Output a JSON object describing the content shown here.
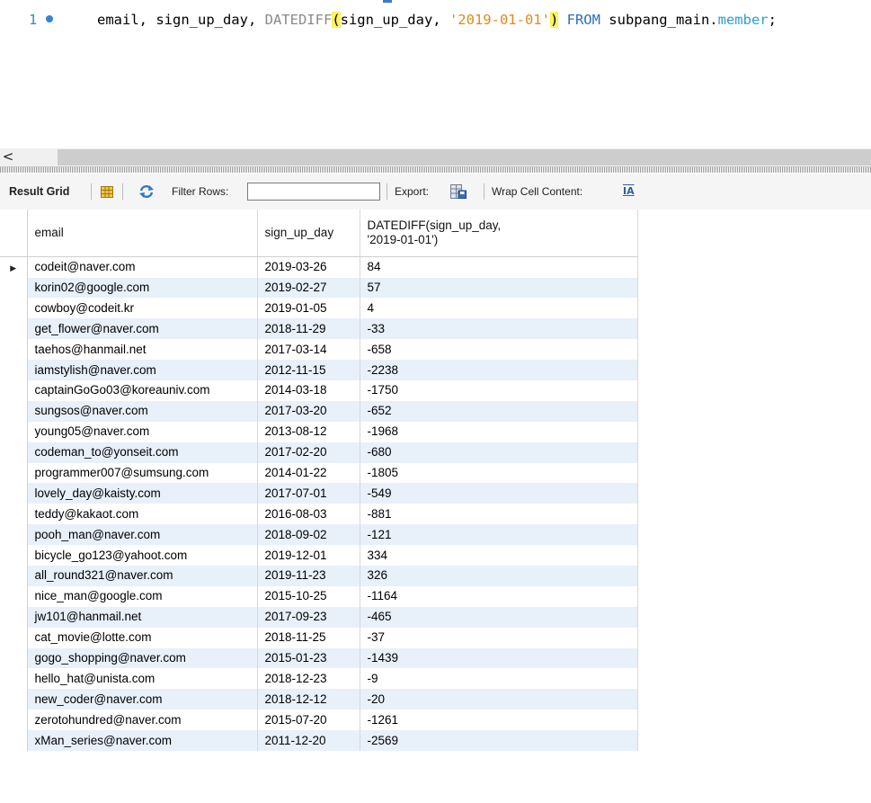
{
  "editor": {
    "line_number": "1",
    "tokens": {
      "t1": "email, sign_up_day, ",
      "t2": "DATEDIFF",
      "t3": "(",
      "t4": "sign_up_day, ",
      "t5": "'2019-01-01'",
      "t6": ")",
      "t7": " FROM",
      "t8": " subpang_main.",
      "t9": "member",
      "t10": ";"
    }
  },
  "scrollbar": {
    "left_arrow": "<"
  },
  "toolbar": {
    "result_grid": "Result Grid",
    "filter_rows": "Filter Rows:",
    "filter_value": "",
    "export": "Export:",
    "wrap_cell_content": "Wrap Cell Content:",
    "wrap_icon_glyph": "IA"
  },
  "grid": {
    "columns": [
      "email",
      "sign_up_day",
      "DATEDIFF(sign_up_day, '2019-01-01')"
    ],
    "column_header_line1": "DATEDIFF(sign_up_day,",
    "column_header_line2": "'2019-01-01')",
    "rows": [
      {
        "email": "codeit@naver.com",
        "day": "2019-03-26",
        "diff": "84"
      },
      {
        "email": "korin02@google.com",
        "day": "2019-02-27",
        "diff": "57"
      },
      {
        "email": "cowboy@codeit.kr",
        "day": "2019-01-05",
        "diff": "4"
      },
      {
        "email": "get_flower@naver.com",
        "day": "2018-11-29",
        "diff": "-33"
      },
      {
        "email": "taehos@hanmail.net",
        "day": "2017-03-14",
        "diff": "-658"
      },
      {
        "email": "iamstylish@naver.com",
        "day": "2012-11-15",
        "diff": "-2238"
      },
      {
        "email": "captainGoGo03@koreauniv.com",
        "day": "2014-03-18",
        "diff": "-1750"
      },
      {
        "email": "sungsos@naver.com",
        "day": "2017-03-20",
        "diff": "-652"
      },
      {
        "email": "young05@naver.com",
        "day": "2013-08-12",
        "diff": "-1968"
      },
      {
        "email": "codeman_to@yonseit.com",
        "day": "2017-02-20",
        "diff": "-680"
      },
      {
        "email": "programmer007@sumsung.com",
        "day": "2014-01-22",
        "diff": "-1805"
      },
      {
        "email": "lovely_day@kaisty.com",
        "day": "2017-07-01",
        "diff": "-549"
      },
      {
        "email": "teddy@kakaot.com",
        "day": "2016-08-03",
        "diff": "-881"
      },
      {
        "email": "pooh_man@naver.com",
        "day": "2018-09-02",
        "diff": "-121"
      },
      {
        "email": "bicycle_go123@yahoot.com",
        "day": "2019-12-01",
        "diff": "334"
      },
      {
        "email": "all_round321@naver.com",
        "day": "2019-11-23",
        "diff": "326"
      },
      {
        "email": "nice_man@google.com",
        "day": "2015-10-25",
        "diff": "-1164"
      },
      {
        "email": "jw101@hanmail.net",
        "day": "2017-09-23",
        "diff": "-465"
      },
      {
        "email": "cat_movie@lotte.com",
        "day": "2018-11-25",
        "diff": "-37"
      },
      {
        "email": "gogo_shopping@naver.com",
        "day": "2015-01-23",
        "diff": "-1439"
      },
      {
        "email": "hello_hat@unista.com",
        "day": "2018-12-23",
        "diff": "-9"
      },
      {
        "email": "new_coder@naver.com",
        "day": "2018-12-12",
        "diff": "-20"
      },
      {
        "email": "zerotohundred@naver.com",
        "day": "2015-07-20",
        "diff": "-1261"
      },
      {
        "email": "xMan_series@naver.com",
        "day": "2011-12-20",
        "diff": "-2569"
      }
    ],
    "current_row_marker": "▶"
  },
  "icons": [
    "grid-icon",
    "refresh-icon",
    "export-icon",
    "wrap-icon",
    "current-row-arrow-icon"
  ],
  "colors": {
    "keyword": "#2f6bc2",
    "string": "#e3881b",
    "function": "#8a8a8a",
    "paren_highlight": "#fff35a",
    "alt_row": "#e8f0fa"
  }
}
